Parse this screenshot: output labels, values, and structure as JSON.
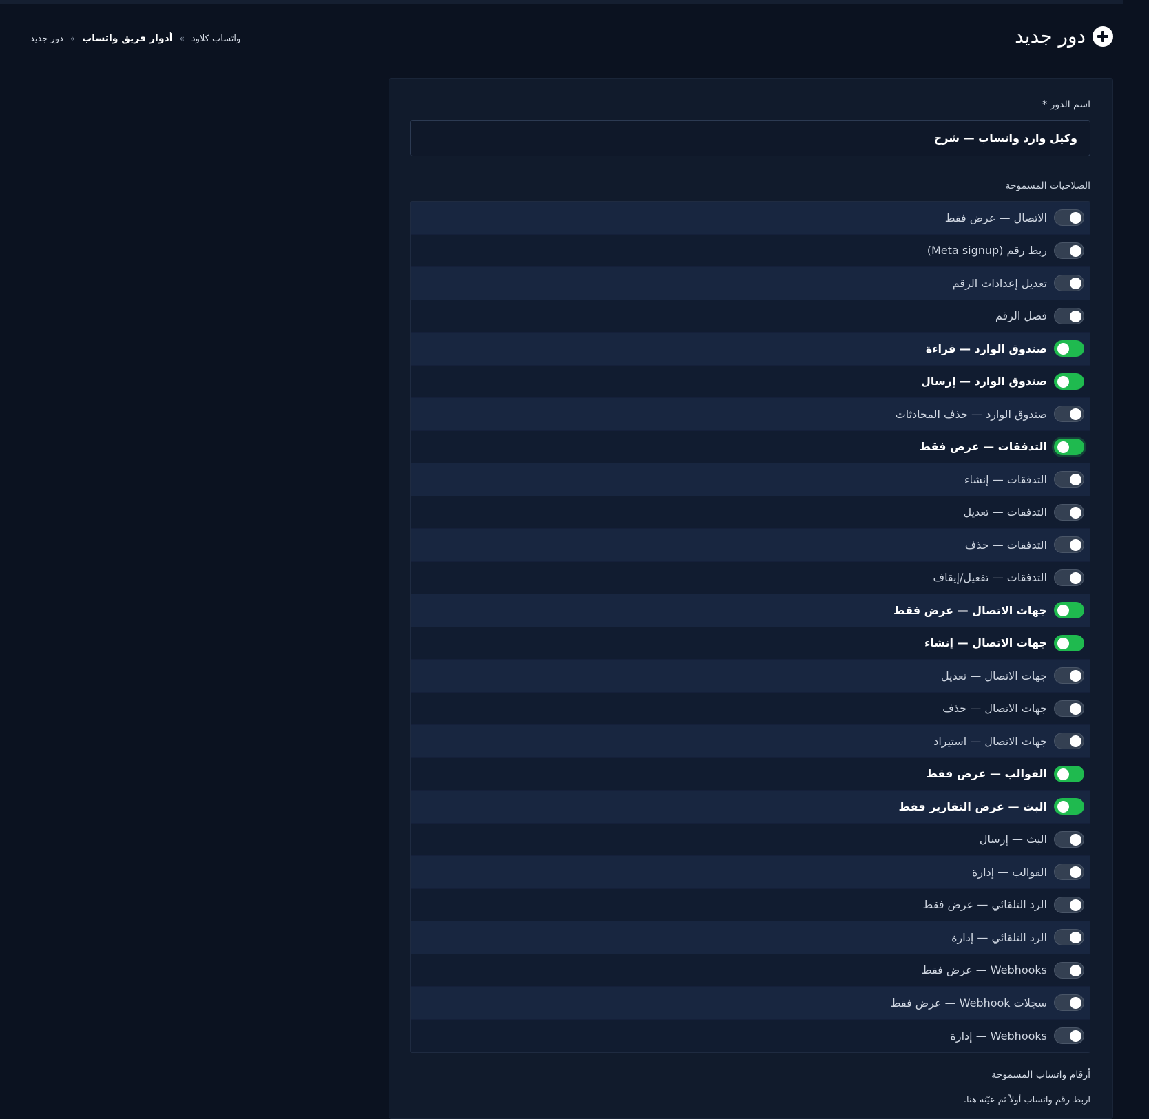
{
  "header": {
    "title": "دور جديد",
    "title_icon": "plus-circle-icon"
  },
  "breadcrumb": {
    "items": [
      "واتساب كلاود",
      "أدوار فريق واتساب",
      "دور جديد"
    ],
    "separator": "»"
  },
  "form": {
    "role_name_label": "اسم الدور *",
    "role_name_value": "وكيل وارد واتساب — شرح",
    "permissions_title": "الصلاحيات المسموحة",
    "permissions": [
      {
        "label": "الاتصال — عرض فقط",
        "enabled": false
      },
      {
        "label": "ربط رقم (Meta signup)",
        "enabled": false
      },
      {
        "label": "تعديل إعدادات الرقم",
        "enabled": false
      },
      {
        "label": "فصل الرقم",
        "enabled": false
      },
      {
        "label": "صندوق الوارد — قراءة",
        "enabled": true
      },
      {
        "label": "صندوق الوارد — إرسال",
        "enabled": true
      },
      {
        "label": "صندوق الوارد — حذف المحادثات",
        "enabled": false
      },
      {
        "label": "التدفقات — عرض فقط",
        "enabled": true,
        "focused": true
      },
      {
        "label": "التدفقات — إنشاء",
        "enabled": false
      },
      {
        "label": "التدفقات — تعديل",
        "enabled": false
      },
      {
        "label": "التدفقات — حذف",
        "enabled": false
      },
      {
        "label": "التدفقات — تفعيل/إيقاف",
        "enabled": false
      },
      {
        "label": "جهات الاتصال — عرض فقط",
        "enabled": true
      },
      {
        "label": "جهات الاتصال — إنشاء",
        "enabled": true
      },
      {
        "label": "جهات الاتصال — تعديل",
        "enabled": false
      },
      {
        "label": "جهات الاتصال — حذف",
        "enabled": false
      },
      {
        "label": "جهات الاتصال — استيراد",
        "enabled": false
      },
      {
        "label": "القوالب — عرض فقط",
        "enabled": true
      },
      {
        "label": "البث — عرض التقارير فقط",
        "enabled": true
      },
      {
        "label": "البث — إرسال",
        "enabled": false
      },
      {
        "label": "القوالب — إدارة",
        "enabled": false
      },
      {
        "label": "الرد التلقائي — عرض فقط",
        "enabled": false
      },
      {
        "label": "الرد التلقائي — إدارة",
        "enabled": false
      },
      {
        "label": "Webhooks — عرض فقط",
        "enabled": false
      },
      {
        "label": "سجلات Webhook — عرض فقط",
        "enabled": false
      },
      {
        "label": "Webhooks — إدارة",
        "enabled": false
      }
    ],
    "numbers_title": "أرقام واتساب المسموحة",
    "numbers_hint": "اربط رقم واتساب أولاً ثم عيّنه هنا."
  },
  "colors": {
    "background": "#0b1220",
    "card": "#111b2c",
    "toggle_on": "#1fba4f",
    "toggle_off": "#344052"
  }
}
